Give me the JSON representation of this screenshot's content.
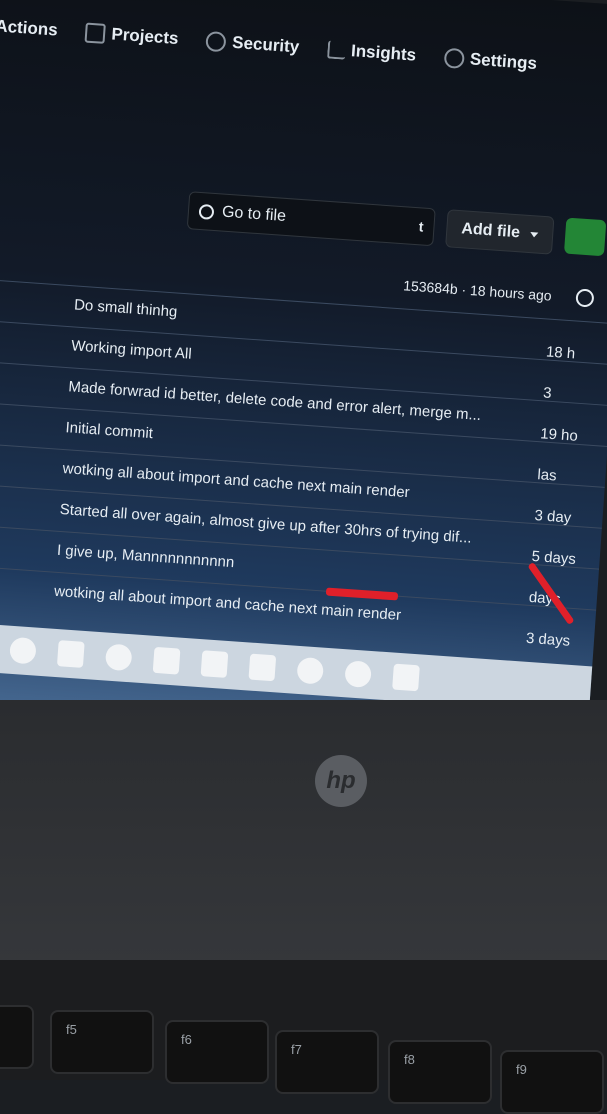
{
  "nav": {
    "items": [
      {
        "label": "Actions"
      },
      {
        "label": "Projects",
        "icon": "table-icon"
      },
      {
        "label": "Security",
        "icon": "shield-icon"
      },
      {
        "label": "Insights",
        "icon": "graph-icon"
      },
      {
        "label": "Settings",
        "icon": "gear-icon"
      }
    ]
  },
  "toolbar": {
    "search_placeholder": "Go to file",
    "search_shortcut": "t",
    "add_file_label": "Add file"
  },
  "commit_bar": {
    "text": "153684b · 18 hours ago"
  },
  "commits": [
    {
      "message": "Do small thinhg",
      "time": "18 h"
    },
    {
      "message": "Working import All",
      "time": "3"
    },
    {
      "message": "Made forwrad id better, delete code and error alert, merge m...",
      "time": "19 ho"
    },
    {
      "message": "Initial commit",
      "time": "las"
    },
    {
      "message": "wotking all about import and cache next main render",
      "time": "3 day"
    },
    {
      "message": "Started all over again, almost give up after 30hrs of trying dif...",
      "time": "5 days"
    },
    {
      "message": "I give up, Mannnnnnnnnnn",
      "time": "days"
    },
    {
      "message": "wotking all about import and cache next main render",
      "time": "3 days"
    }
  ],
  "keys": [
    {
      "label": "f5"
    },
    {
      "label": "f6"
    },
    {
      "label": "f7"
    },
    {
      "label": "f8"
    },
    {
      "label": "f9"
    }
  ],
  "logo": {
    "text": "hp"
  },
  "colors": {
    "annotation": "#e0202a",
    "primary": "#238636"
  }
}
